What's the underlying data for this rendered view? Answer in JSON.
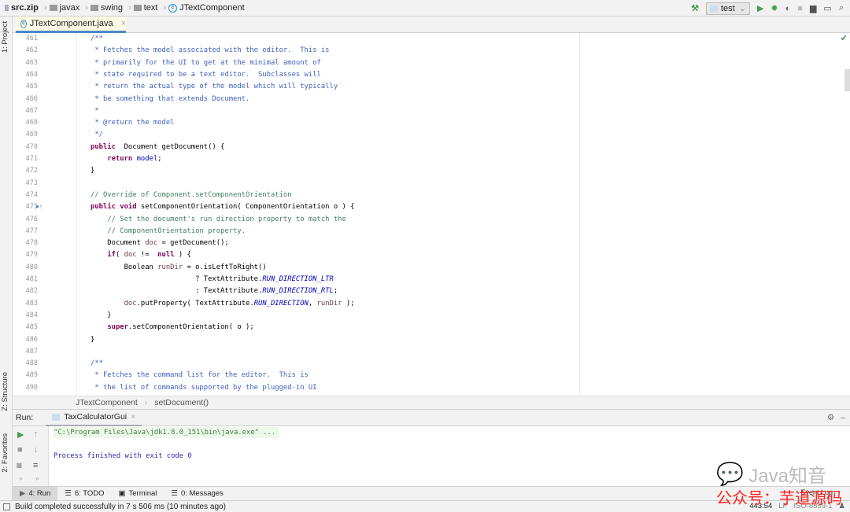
{
  "nav": {
    "crumbs": [
      "src.zip",
      "javax",
      "swing",
      "text",
      "JTextComponent"
    ]
  },
  "toolbar": {
    "run_config": "test",
    "icons": [
      "build-hammer-icon",
      "run-icon",
      "debug-icon",
      "coverage-icon",
      "stop-icon",
      "project-structure-icon",
      "terminal-icon",
      "search-icon"
    ],
    "accent": "#499c54"
  },
  "sidebar": {
    "project": "1: Project",
    "structure": "Z: Structure",
    "favorites": "2: Favorites"
  },
  "editor": {
    "tab": "JTextComponent.java",
    "lines": [
      {
        "n": "461",
        "t": [
          [
            "d",
            "/**"
          ]
        ]
      },
      {
        "n": "462",
        "t": [
          [
            "d",
            " * Fetches the model associated with the editor.  This is"
          ]
        ]
      },
      {
        "n": "463",
        "t": [
          [
            "d",
            " * primarily for the UI to get at the minimal amount of"
          ]
        ]
      },
      {
        "n": "464",
        "t": [
          [
            "d",
            " * state required to be a text editor.  Subclasses will"
          ]
        ]
      },
      {
        "n": "465",
        "t": [
          [
            "d",
            " * return the actual type of the model which will typically"
          ]
        ]
      },
      {
        "n": "466",
        "t": [
          [
            "d",
            " * be something that extends Document."
          ]
        ]
      },
      {
        "n": "467",
        "t": [
          [
            "d",
            " *"
          ]
        ]
      },
      {
        "n": "468",
        "t": [
          [
            "d",
            " * @return the model"
          ]
        ]
      },
      {
        "n": "469",
        "t": [
          [
            "d",
            " */"
          ]
        ]
      },
      {
        "n": "470",
        "t": [
          [
            "k",
            "public"
          ],
          [
            "",
            "  Document getDocument() {"
          ]
        ]
      },
      {
        "n": "471",
        "t": [
          [
            "",
            "    "
          ],
          [
            "k",
            "return"
          ],
          [
            "",
            " "
          ],
          [
            "f",
            "model"
          ],
          [
            "",
            ";"
          ]
        ]
      },
      {
        "n": "472",
        "t": [
          [
            "",
            "}"
          ]
        ]
      },
      {
        "n": "473",
        "t": []
      },
      {
        "n": "474",
        "t": [
          [
            "c",
            "// Override of Component.setComponentOrientation"
          ]
        ]
      },
      {
        "n": "475",
        "t": [
          [
            "k",
            "public void"
          ],
          [
            "",
            " setComponentOrientation( ComponentOrientation o ) {"
          ]
        ]
      },
      {
        "n": "476",
        "t": [
          [
            "",
            "    "
          ],
          [
            "c",
            "// Set the document's run direction property to match the"
          ]
        ]
      },
      {
        "n": "477",
        "t": [
          [
            "",
            "    "
          ],
          [
            "c",
            "// ComponentOrientation property."
          ]
        ]
      },
      {
        "n": "478",
        "t": [
          [
            "",
            "    Document "
          ],
          [
            "v",
            "doc"
          ],
          [
            "",
            " = getDocument();"
          ]
        ]
      },
      {
        "n": "479",
        "t": [
          [
            "",
            "    "
          ],
          [
            "k",
            "if"
          ],
          [
            "",
            "( "
          ],
          [
            "v",
            "doc"
          ],
          [
            "",
            " !=  "
          ],
          [
            "k",
            "null"
          ],
          [
            "",
            " ) {"
          ]
        ]
      },
      {
        "n": "480",
        "t": [
          [
            "",
            "        Boolean "
          ],
          [
            "v",
            "runDir"
          ],
          [
            "",
            " = o.isLeftToRight()"
          ]
        ]
      },
      {
        "n": "481",
        "t": [
          [
            "",
            "                         ? TextAttribute."
          ],
          [
            "s",
            "RUN_DIRECTION_LTR"
          ]
        ]
      },
      {
        "n": "482",
        "t": [
          [
            "",
            "                         : TextAttribute."
          ],
          [
            "s",
            "RUN_DIRECTION_RTL"
          ],
          [
            "",
            ";"
          ]
        ]
      },
      {
        "n": "483",
        "t": [
          [
            "",
            "        "
          ],
          [
            "v",
            "doc"
          ],
          [
            "",
            ".putProperty( TextAttribute."
          ],
          [
            "s",
            "RUN_DIRECTION"
          ],
          [
            "",
            ", "
          ],
          [
            "v",
            "runDir"
          ],
          [
            "",
            " );"
          ]
        ]
      },
      {
        "n": "484",
        "t": [
          [
            "",
            "    }"
          ]
        ]
      },
      {
        "n": "485",
        "t": [
          [
            "",
            "    "
          ],
          [
            "k",
            "super"
          ],
          [
            "",
            ".setComponentOrientation( o );"
          ]
        ]
      },
      {
        "n": "486",
        "t": [
          [
            "",
            "}"
          ]
        ]
      },
      {
        "n": "487",
        "t": []
      },
      {
        "n": "488",
        "t": [
          [
            "d",
            "/**"
          ]
        ]
      },
      {
        "n": "489",
        "t": [
          [
            "d",
            " * Fetches the command list for the editor.  This is"
          ]
        ]
      },
      {
        "n": "490",
        "t": [
          [
            "d",
            " * the list of commands supported by the plugged-in UI"
          ]
        ]
      }
    ],
    "breadcrumb": [
      "JTextComponent",
      "setDocument()"
    ]
  },
  "run": {
    "label": "Run:",
    "tab": "TaxCalculatorGui",
    "console": [
      "\"C:\\Program Files\\Java\\jdk1.8.0_151\\bin\\java.exe\" ...",
      "",
      "Process finished with exit code 0"
    ]
  },
  "bottom_tabs": [
    {
      "label": "4: Run",
      "icon": "run-icon"
    },
    {
      "label": "6: TODO",
      "icon": "list-icon"
    },
    {
      "label": "Terminal",
      "icon": "terminal-icon"
    },
    {
      "label": "0: Messages",
      "icon": "messages-icon"
    }
  ],
  "status": {
    "message": "Build completed successfully in 7 s 506 ms (10 minutes ago)",
    "position": "443:54",
    "line_sep": "LF",
    "encoding": "ISO-8859-1",
    "event_log": "Event Log"
  },
  "watermark": {
    "line1": "Java知音",
    "line2": "公众号：芋道源码"
  }
}
